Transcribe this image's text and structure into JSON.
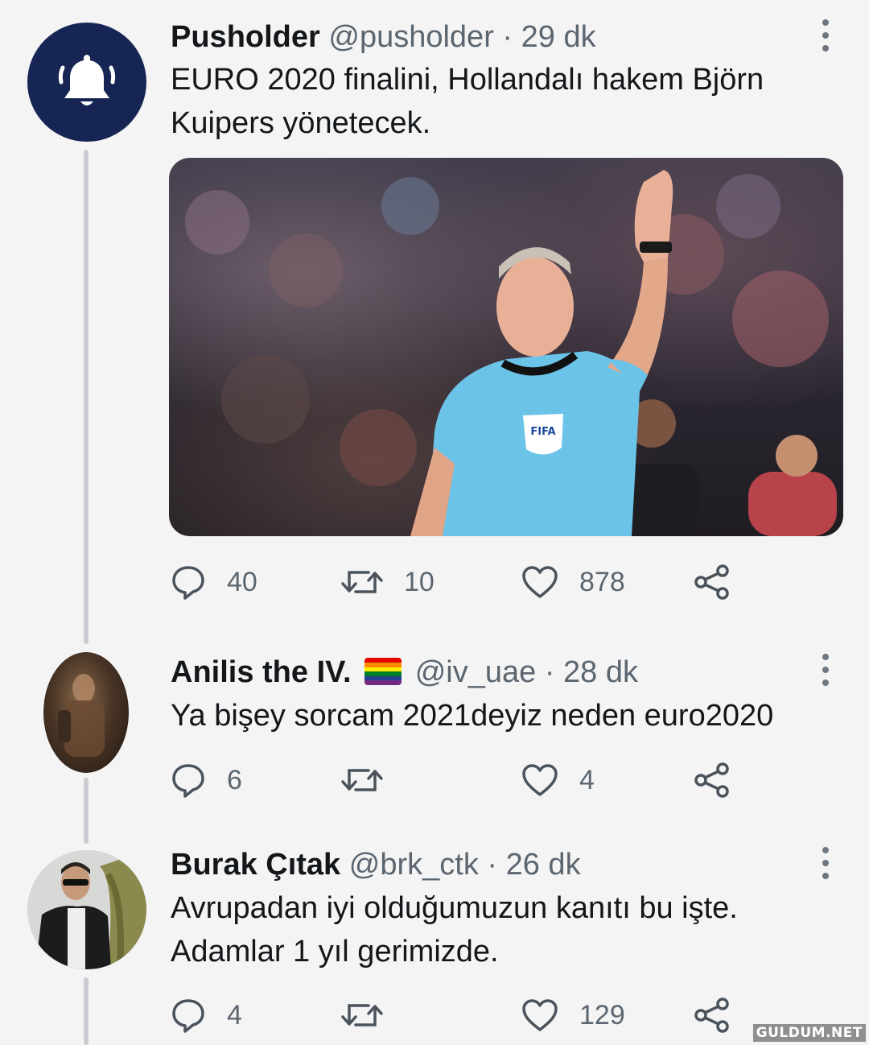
{
  "tweets": [
    {
      "name": "Pusholder",
      "handle": "@pusholder",
      "separator": "·",
      "time": "29 dk",
      "text_line1": "EURO 2020 finalini, Hollandalı hakem Björn",
      "text_line2": "Kuipers yönetecek.",
      "replies": "40",
      "retweets": "10",
      "likes": "878",
      "avatar_icon": "bell-icon",
      "media_description_text": "REFEREE FIFA"
    },
    {
      "name": "Anilis the IV.",
      "flag_icon": "rainbow-flag-icon",
      "handle": "@iv_uae",
      "separator": "·",
      "time": "28 dk",
      "text_line1": "Ya bişey sorcam 2021deyiz neden euro2020",
      "replies": "6",
      "retweets": "",
      "likes": "4"
    },
    {
      "name": "Burak Çıtak",
      "handle": "@brk_ctk",
      "separator": "·",
      "time": "26 dk",
      "text_line1": "Avrupadan iyi olduğumuzun kanıtı bu işte.",
      "text_line2": "Adamlar 1 yıl gerimizde.",
      "replies": "4",
      "retweets": "",
      "likes": "129"
    }
  ],
  "watermark": "GULDUM.NET",
  "colors": {
    "bell_avatar_bg": "#172554",
    "thread_line": "#c9ccd0",
    "muted_text": "#5b6670"
  }
}
